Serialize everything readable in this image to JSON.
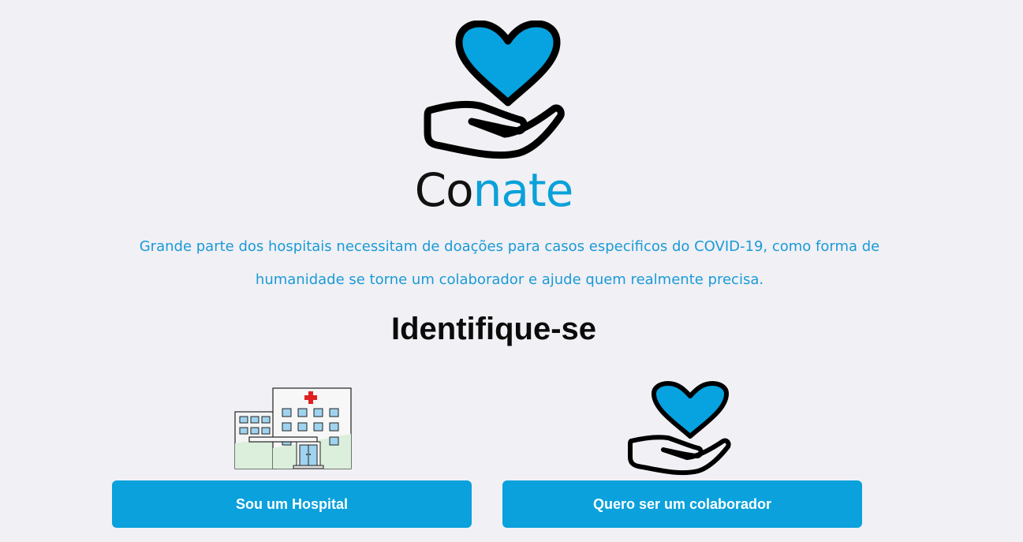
{
  "brand": {
    "name_part1": "Co",
    "name_part2": "nate",
    "logo_icon": "heart-in-hand-icon"
  },
  "intro": {
    "line1": "Grande parte dos hospitais necessitam de doações para casos especificos do COVID-19, como forma de",
    "line2": "humanidade se torne um colaborador e ajude quem realmente precisa."
  },
  "identify": {
    "heading": "Identifique-se",
    "options": [
      {
        "icon": "hospital-building-icon",
        "button_label": "Sou um Hospital"
      },
      {
        "icon": "heart-in-hand-icon",
        "button_label": "Quero ser um colaborador"
      }
    ]
  },
  "colors": {
    "background": "#f0f0f5",
    "accent": "#0aa1dc",
    "text_dark": "#0b0b0b",
    "intro_text": "#1b9ad6"
  }
}
